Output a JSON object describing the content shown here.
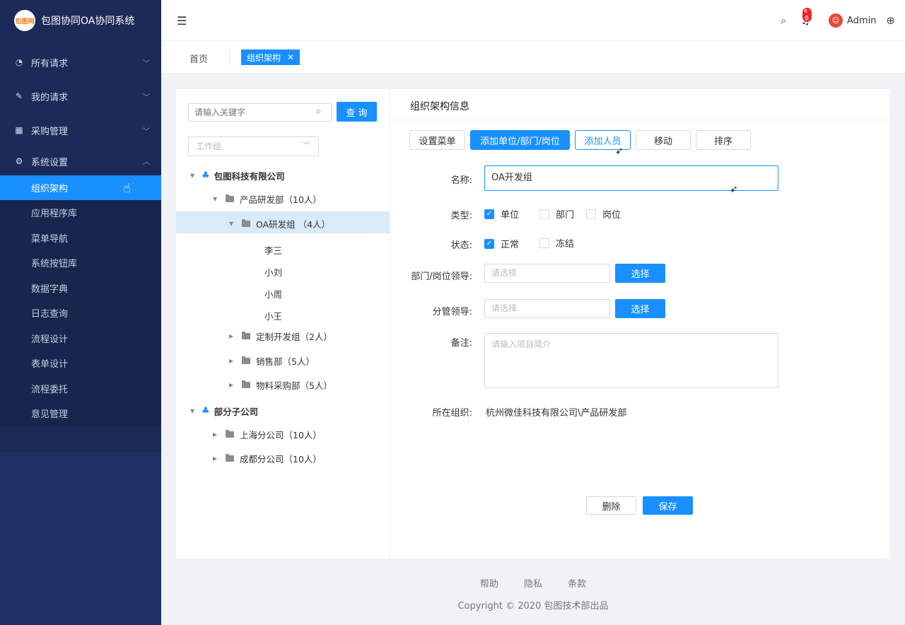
{
  "app": {
    "title": "包图协同OA协同系统",
    "logo_text": "包图网"
  },
  "sidebar": {
    "menus": [
      {
        "label": "所有请求",
        "icon": "gauge-icon"
      },
      {
        "label": "我的请求",
        "icon": "edit-icon"
      },
      {
        "label": "采购管理",
        "icon": "table-icon"
      },
      {
        "label": "系统设置",
        "icon": "gear-icon"
      }
    ],
    "submenu": [
      "组织架构",
      "应用程序库",
      "菜单导航",
      "系统按钮库",
      "数据字典",
      "日志查询",
      "流程设计",
      "表单设计",
      "流程委托",
      "意见管理"
    ]
  },
  "header": {
    "notification_badge": "6条",
    "user": "Admin"
  },
  "tabs": {
    "home": "首页",
    "active": "组织架构"
  },
  "tree": {
    "search_placeholder": "请输入关键字",
    "query_label": "查 询",
    "group_placeholder": "工作组",
    "nodes": {
      "company": "包图科技有限公司",
      "dept_rd": "产品研发部（10人）",
      "oa_group": "OA研发组",
      "oa_count": "（4人）",
      "members": [
        "李三",
        "小刘",
        "小周",
        "小王"
      ],
      "custom_group": "定制开发组（2人）",
      "sales": "销售部（5人）",
      "purchase": "物料采购部（5人）",
      "subsidiary": "部分子公司",
      "shanghai": "上海分公司（10人）",
      "chengdu": "成都分公司（10人）"
    }
  },
  "form": {
    "title": "组织架构信息",
    "toolbar": [
      "设置菜单",
      "添加单位/部门/岗位",
      "添加人员",
      "移动",
      "排序"
    ],
    "name_label": "名称:",
    "name_value": "OA开发组",
    "type_label": "类型:",
    "types": [
      "单位",
      "部门",
      "岗位"
    ],
    "status_label": "状态:",
    "statuses": [
      "正常",
      "冻结"
    ],
    "leader_label": "部门/岗位领导:",
    "leader_placeholder": "请选择",
    "manager_label": "分管领导:",
    "manager_placeholder": "请选择",
    "select_label": "选择",
    "remark_label": "备注:",
    "remark_placeholder": "请输入项目简介",
    "org_label": "所在组织:",
    "org_value": "杭州微佳科技有限公司\\产品研发部",
    "delete_label": "删除",
    "save_label": "保存"
  },
  "footer": {
    "links": [
      "帮助",
      "隐私",
      "条款"
    ],
    "copyright": "Copyright © 2020 包图技术部出品"
  },
  "colors": {
    "primary": "#1890ff",
    "sidebar": "#1b2a57"
  }
}
